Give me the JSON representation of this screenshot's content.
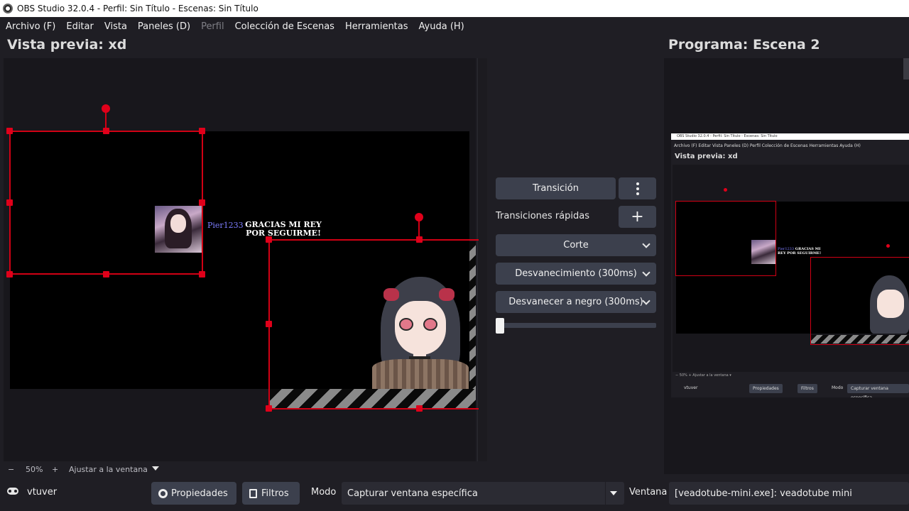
{
  "window": {
    "title": "OBS Studio 32.0.4 - Perfil: Sin Título - Escenas: Sin Título"
  },
  "menu": {
    "items": [
      {
        "label": "Archivo (F)",
        "enabled": true
      },
      {
        "label": "Editar",
        "enabled": true
      },
      {
        "label": "Vista",
        "enabled": true
      },
      {
        "label": "Paneles (D)",
        "enabled": true
      },
      {
        "label": "Perfil",
        "enabled": false
      },
      {
        "label": "Colección de Escenas",
        "enabled": true
      },
      {
        "label": "Herramientas",
        "enabled": true
      },
      {
        "label": "Ayuda (H)",
        "enabled": true
      }
    ]
  },
  "preview": {
    "title": "Vista previa: xd",
    "chat_user": "Pier1233",
    "chat_message": "GRACIAS MI REY POR SEGUIRME!",
    "zoom": {
      "minus": "−",
      "value": "50%",
      "plus": "+",
      "fit": "Ajustar a la ventana"
    }
  },
  "transitions": {
    "transition_button": "Transición",
    "quick_label": "Transiciones rápidas",
    "quick_add": "+",
    "items": [
      "Corte",
      "Desvanecimiento (300ms)",
      "Desvanecer a negro (300ms)"
    ],
    "slider_value": 0
  },
  "program": {
    "title": "Programa: Escena 2",
    "mini_title": "OBS Studio 32.0.4 - Perfil: Sin Título - Escenas: Sin Título",
    "mini_menu": "Archivo (F)   Editar   Vista   Paneles (D)   Perfil   Colección de Escenas   Herramientas   Ayuda (H)",
    "mini_preview_title": "Vista previa: xd",
    "mini_zoom": "−   50%   +   Ajustar a la ventana   ▾",
    "mini_source": "vtuver",
    "mini_props": "Propiedades",
    "mini_filters": "Filtros",
    "mini_mode": "Modo",
    "mini_mode_value": "Capturar ventana específica",
    "mini_chat_user": "Pier1233",
    "mini_chat_msg": "GRACIAS MI REY POR SEGUIRME!"
  },
  "source_bar": {
    "source_name": "vtuver",
    "properties": "Propiedades",
    "filters": "Filtros",
    "mode_label": "Modo",
    "mode_value": "Capturar ventana específica",
    "window_label": "Ventana",
    "window_value": "[veadotube-mini.exe]: veadotube mini"
  },
  "colors": {
    "selection": "#d10014",
    "button": "#3c404d",
    "background": "#1f1e24",
    "chat_user": "#7d7dff"
  }
}
